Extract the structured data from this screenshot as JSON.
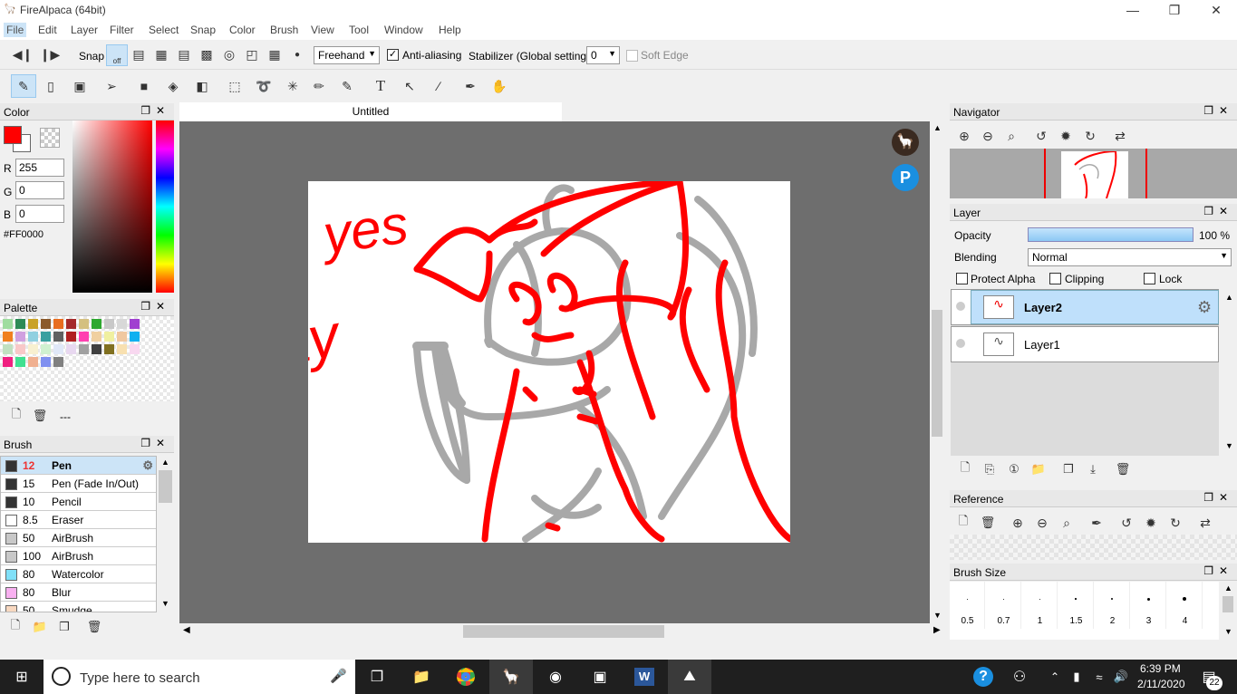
{
  "window": {
    "title": "FireAlpaca (64bit)"
  },
  "menu": [
    "File",
    "Edit",
    "Layer",
    "Filter",
    "Select",
    "Snap",
    "Color",
    "Brush",
    "View",
    "Tool",
    "Window",
    "Help"
  ],
  "toolbar": {
    "snap_label": "Snap",
    "snap_off": "off",
    "mode": "Freehand",
    "antialias_label": "Anti-aliasing",
    "stabilizer_label": "Stabilizer (Global settings)",
    "stabilizer_value": "0",
    "soft_edge_label": "Soft Edge"
  },
  "color_panel": {
    "title": "Color",
    "r_label": "R",
    "r": "255",
    "g_label": "G",
    "g": "0",
    "b_label": "B",
    "b": "0",
    "hex": "#FF0000",
    "primary": "#ff0000"
  },
  "palette_panel": {
    "title": "Palette",
    "name": "---"
  },
  "brush_panel": {
    "title": "Brush",
    "items": [
      {
        "size": "12",
        "name": "Pen",
        "color": "#333333"
      },
      {
        "size": "15",
        "name": "Pen (Fade In/Out)",
        "color": "#333333"
      },
      {
        "size": "10",
        "name": "Pencil",
        "color": "#333333"
      },
      {
        "size": "8.5",
        "name": "Eraser",
        "color": "#ffffff"
      },
      {
        "size": "50",
        "name": "AirBrush",
        "color": "#c8c8c8"
      },
      {
        "size": "100",
        "name": "AirBrush",
        "color": "#c8c8c8"
      },
      {
        "size": "80",
        "name": "Watercolor",
        "color": "#80e0f8"
      },
      {
        "size": "80",
        "name": "Blur",
        "color": "#f8b0f0"
      },
      {
        "size": "50",
        "name": "Smudge",
        "color": "#f8d8c0"
      }
    ]
  },
  "document": {
    "tab": "Untitled",
    "text1": "yes",
    "text2": "gay"
  },
  "navigator": {
    "title": "Navigator"
  },
  "layer_panel": {
    "title": "Layer",
    "opacity_label": "Opacity",
    "opacity_value": "100 %",
    "opacity_fraction": 1.0,
    "blending_label": "Blending",
    "blending_value": "Normal",
    "protect_alpha": "Protect Alpha",
    "clipping": "Clipping",
    "lock": "Lock",
    "layers": [
      "Layer2",
      "Layer1"
    ]
  },
  "reference": {
    "title": "Reference"
  },
  "brush_size": {
    "title": "Brush Size",
    "sizes": [
      "0.5",
      "0.7",
      "1",
      "1.5",
      "2",
      "3",
      "4"
    ]
  },
  "taskbar": {
    "search_placeholder": "Type here to search",
    "time": "6:39 PM",
    "date": "2/11/2020",
    "notifications": "22"
  }
}
